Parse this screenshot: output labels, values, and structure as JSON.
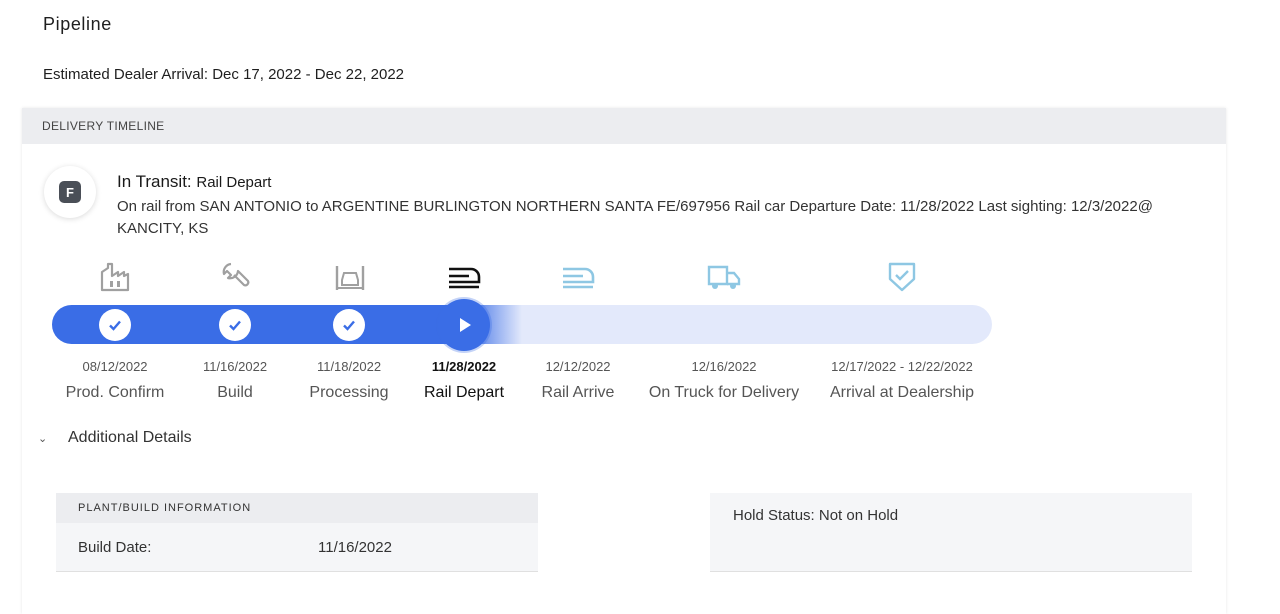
{
  "page": {
    "title": "Pipeline",
    "estimated_arrival": "Estimated Dealer Arrival: Dec 17, 2022 - Dec 22, 2022"
  },
  "timeline": {
    "header": "DELIVERY TIMELINE",
    "badge_letter": "F",
    "status_label": "In Transit:",
    "status_value": "Rail Depart",
    "description": "On rail from SAN ANTONIO to ARGENTINE BURLINGTON NORTHERN SANTA FE/697956 Rail car Departure Date: 11/28/2022 Last sighting: 12/3/2022@ KANCITY, KS",
    "progress_fraction": 0.5,
    "steps": [
      {
        "date": "08/12/2022",
        "label": "Prod. Confirm",
        "state": "done",
        "icon": "factory-icon"
      },
      {
        "date": "11/16/2022",
        "label": "Build",
        "state": "done",
        "icon": "wrench-icon"
      },
      {
        "date": "11/18/2022",
        "label": "Processing",
        "state": "done",
        "icon": "car-lift-icon"
      },
      {
        "date": "11/28/2022",
        "label": "Rail Depart",
        "state": "current",
        "icon": "train-icon"
      },
      {
        "date": "12/12/2022",
        "label": "Rail Arrive",
        "state": "pending",
        "icon": "train-arrive-icon"
      },
      {
        "date": "12/16/2022",
        "label": "On Truck for Delivery",
        "state": "pending",
        "icon": "truck-icon"
      },
      {
        "date": "12/17/2022 - 12/22/2022",
        "label": "Arrival at Dealership",
        "state": "pending",
        "icon": "shield-check-icon"
      }
    ],
    "colors": {
      "accent": "#3a6de6",
      "track": "#e3e9fb",
      "done_icon": "#9a9a9a",
      "pending_icon": "#8ec7e3"
    }
  },
  "details": {
    "toggle_label": "Additional Details",
    "plant": {
      "header": "PLANT/BUILD INFORMATION",
      "build_date_label": "Build Date:",
      "build_date_value": "11/16/2022"
    },
    "hold_status": "Hold Status: Not on Hold"
  }
}
